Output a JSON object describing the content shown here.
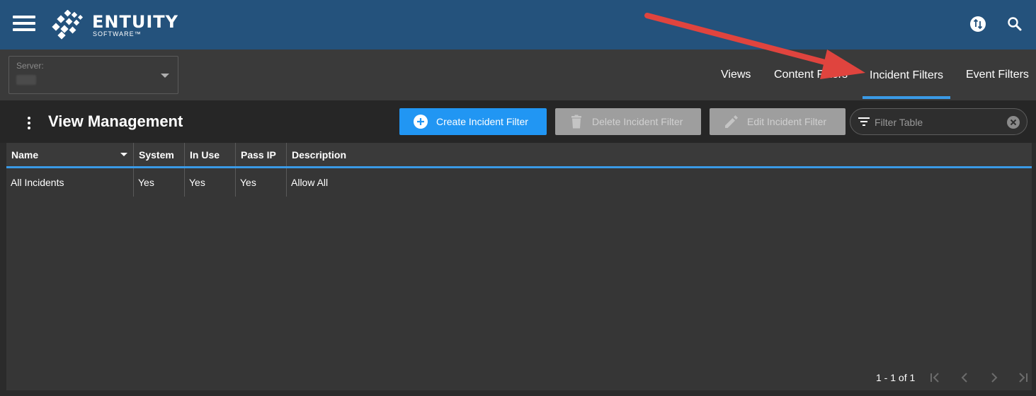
{
  "header": {
    "logo_text": "ENTUITY",
    "logo_sub": "SOFTWARE™",
    "icons": {
      "menu": "hamburger-menu-icon",
      "sync": "sync-icon",
      "search": "search-icon"
    }
  },
  "subbar": {
    "server_label": "Server:",
    "tabs": [
      {
        "label": "Views"
      },
      {
        "label": "Content Filters"
      },
      {
        "label": "Incident Filters",
        "active": true
      },
      {
        "label": "Event Filters"
      }
    ]
  },
  "toolbar": {
    "title": "View Management",
    "create_label": "Create Incident Filter",
    "delete_label": "Delete Incident Filter",
    "edit_label": "Edit Incident Filter",
    "filter_placeholder": "Filter Table"
  },
  "table": {
    "columns": [
      "Name",
      "System",
      "In Use",
      "Pass IP",
      "Description"
    ],
    "rows": [
      {
        "name": "All Incidents",
        "system": "Yes",
        "in_use": "Yes",
        "pass_ip": "Yes",
        "description": "Allow All"
      }
    ]
  },
  "pager": {
    "text": "1 - 1 of 1"
  },
  "colors": {
    "header_bg": "#24527c",
    "accent": "#2196f3",
    "underline": "#3a9ae6",
    "annotation_arrow": "#e0443e"
  }
}
